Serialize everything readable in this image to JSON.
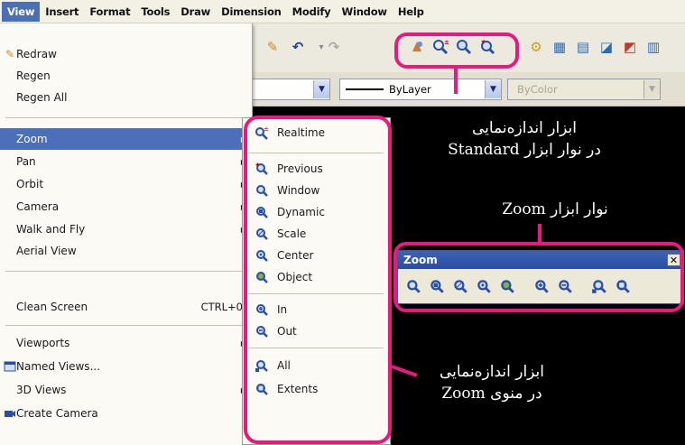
{
  "menubar": {
    "items": [
      "View",
      "Insert",
      "Format",
      "Tools",
      "Draw",
      "Dimension",
      "Modify",
      "Window",
      "Help"
    ]
  },
  "properties": {
    "linetype_value": "ByLayer",
    "color_value": "ByColor"
  },
  "view_menu": {
    "items": [
      {
        "label": "Redraw",
        "shortcut": ""
      },
      {
        "label": "Regen",
        "shortcut": ""
      },
      {
        "label": "Regen All",
        "shortcut": ""
      },
      {
        "label": "Zoom",
        "shortcut": ""
      },
      {
        "label": "Pan",
        "shortcut": ""
      },
      {
        "label": "Orbit",
        "shortcut": ""
      },
      {
        "label": "Camera",
        "shortcut": ""
      },
      {
        "label": "Walk and Fly",
        "shortcut": ""
      },
      {
        "label": "Aerial View",
        "shortcut": ""
      },
      {
        "label": "Clean Screen",
        "shortcut": "CTRL+0"
      },
      {
        "label": "Viewports",
        "shortcut": ""
      },
      {
        "label": "Named Views...",
        "shortcut": ""
      },
      {
        "label": "3D Views",
        "shortcut": ""
      },
      {
        "label": "Create Camera",
        "shortcut": ""
      }
    ]
  },
  "zoom_menu": {
    "items": [
      "Realtime",
      "Previous",
      "Window",
      "Dynamic",
      "Scale",
      "Center",
      "Object",
      "In",
      "Out",
      "All",
      "Extents"
    ]
  },
  "zoom_toolbar": {
    "title": "Zoom",
    "close": "✕"
  },
  "annotations": {
    "standard_line1": "ابزار اندازه‌نمایی",
    "standard_line2": "در نوار ابزار Standard",
    "zoom_toolbar": "نوار ابزار Zoom",
    "menu_line1": "ابزار اندازه‌نمایی",
    "menu_line2": "در منوی Zoom"
  },
  "colors": {
    "highlight": "#e8197f",
    "menu_selection": "#4b6fb8",
    "titlebar": "#2a4da0"
  }
}
